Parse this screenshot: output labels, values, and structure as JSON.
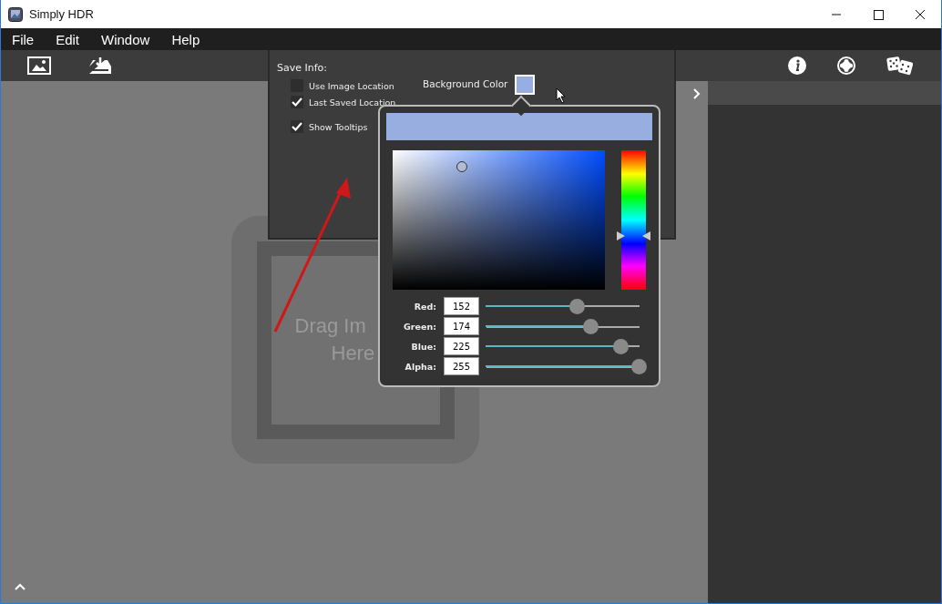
{
  "window": {
    "title": "Simply HDR"
  },
  "menu": [
    "File",
    "Edit",
    "Window",
    "Help"
  ],
  "settings": {
    "heading": "Save Info:",
    "options": [
      {
        "label": "Use Image Location",
        "checked": false
      },
      {
        "label": "Last Saved Location",
        "checked": true
      },
      {
        "label": "Show Tooltips",
        "checked": true
      }
    ],
    "background_color_label": "Background Color"
  },
  "color_picker": {
    "hue": {
      "level": 0.383
    },
    "channels": [
      {
        "label": "Red:",
        "value": "152",
        "level": 0.596
      },
      {
        "label": "Green:",
        "value": "174",
        "level": 0.682
      },
      {
        "label": "Blue:",
        "value": "225",
        "level": 0.882
      },
      {
        "label": "Alpha:",
        "value": "255",
        "level": 1
      }
    ]
  },
  "drop_zone": {
    "lines": [
      "Drag Im",
      "Here"
    ]
  }
}
